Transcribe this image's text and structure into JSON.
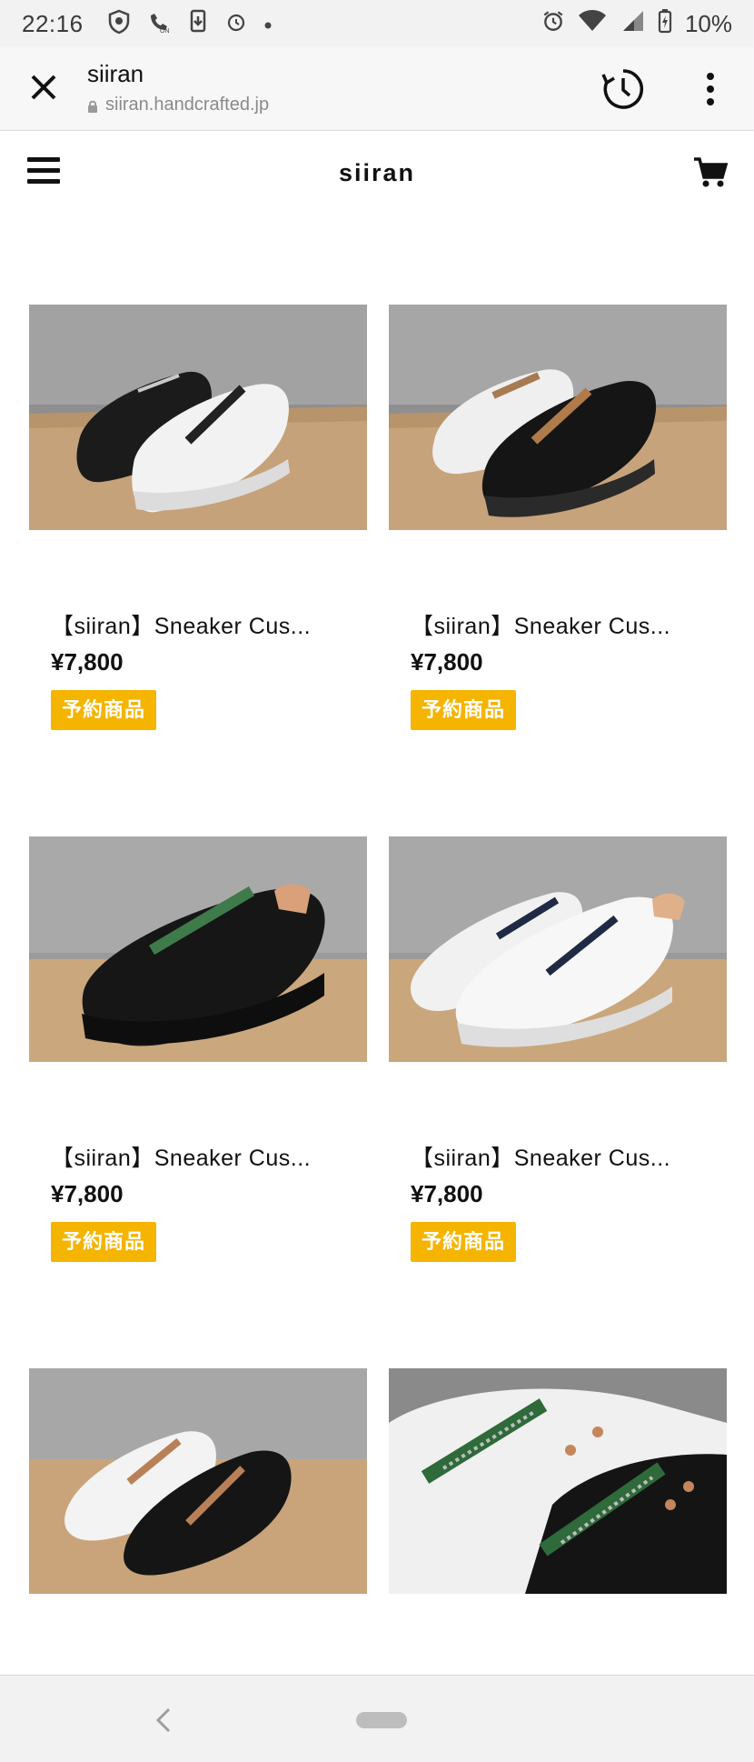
{
  "status_bar": {
    "time": "22:16",
    "battery": "10%",
    "icons_left": [
      "shield-icon",
      "call-on-icon",
      "download-icon",
      "alarm-icon",
      "dot-icon"
    ],
    "icons_right": [
      "alarm-icon",
      "wifi-icon",
      "signal-icon",
      "battery-icon"
    ]
  },
  "browser": {
    "title": "siiran",
    "url": "siiran.handcrafted.jp"
  },
  "site": {
    "brand": "siiran"
  },
  "products": [
    {
      "name": "【siiran】Sneaker Cus...",
      "price": "¥7,800",
      "badge": "予約商品",
      "image": "black-and-white-zip-sneakers-pair"
    },
    {
      "name": "【siiran】Sneaker Cus...",
      "price": "¥7,800",
      "badge": "予約商品",
      "image": "white-and-black-zip-sneakers-pair"
    },
    {
      "name": "【siiran】Sneaker Cus...",
      "price": "¥7,800",
      "badge": "予約商品",
      "image": "black-sneaker-green-zip"
    },
    {
      "name": "【siiran】Sneaker Cus...",
      "price": "¥7,800",
      "badge": "予約商品",
      "image": "white-sneakers-navy-zip"
    },
    {
      "image": "white-and-black-sneakers-tan-zip"
    },
    {
      "image": "zip-detail-closeup"
    }
  ],
  "colors": {
    "badge": "#f5b400",
    "wood": "#c9a57a",
    "wall": "#9a9a9a"
  }
}
